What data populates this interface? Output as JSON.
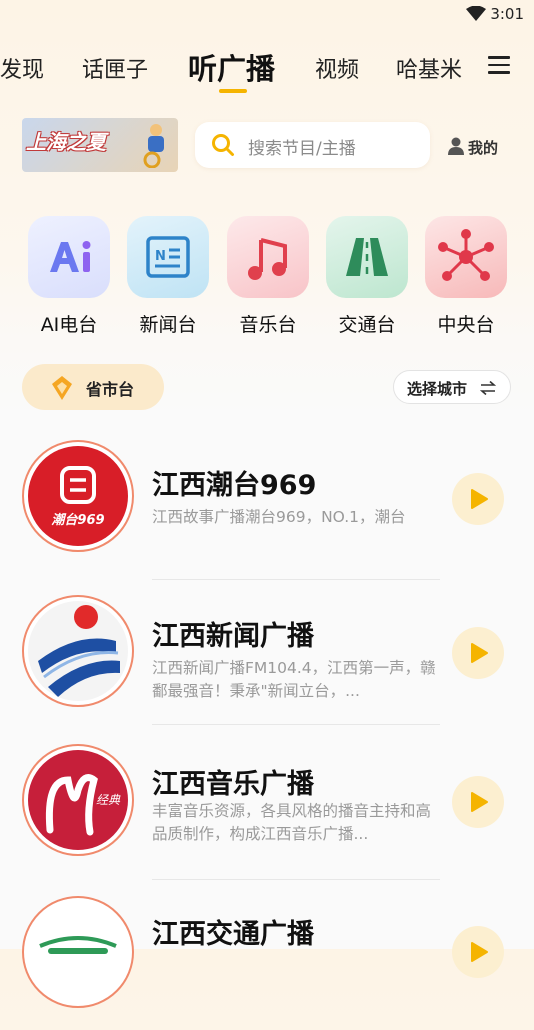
{
  "status_bar": {
    "time": "3:01"
  },
  "tabs": [
    {
      "label": "发现",
      "active": false
    },
    {
      "label": "话匣子",
      "active": false
    },
    {
      "label": "听广播",
      "active": true
    },
    {
      "label": "视频",
      "active": false
    },
    {
      "label": "哈基米",
      "active": false
    }
  ],
  "banner": {
    "text": "上海之夏"
  },
  "search": {
    "placeholder": "搜索节目/主播"
  },
  "profile": {
    "label": "我的"
  },
  "categories": [
    {
      "label": "AI电台",
      "icon": "ai-icon",
      "color": "#6b78f0"
    },
    {
      "label": "新闻台",
      "icon": "news-icon",
      "color": "#2d83c9"
    },
    {
      "label": "音乐台",
      "icon": "music-note-icon",
      "color": "#e0404d"
    },
    {
      "label": "交通台",
      "icon": "road-icon",
      "color": "#2e8c5b"
    },
    {
      "label": "中央台",
      "icon": "network-icon",
      "color": "#e0384a"
    }
  ],
  "province": {
    "label": "省市台"
  },
  "city_select": {
    "label": "选择城市"
  },
  "stations": [
    {
      "name": "江西潮台969",
      "desc": "江西故事广播潮台969，NO.1，潮台",
      "logo_text": "潮台969"
    },
    {
      "name": "江西新闻广播",
      "desc": "江西新闻广播FM104.4，江西第一声，赣鄱最强音！秉承\"新闻立台，...",
      "logo_text": ""
    },
    {
      "name": "江西音乐广播",
      "desc": "丰富音乐资源，各具风格的播音主持和高品质制作，构成江西音乐广播...",
      "logo_text": "经典"
    },
    {
      "name": "江西交通广播",
      "desc": "",
      "logo_text": ""
    }
  ],
  "colors": {
    "accent": "#f5b400",
    "play_bg": "#fcefd0",
    "play_icon": "#f5b400"
  }
}
